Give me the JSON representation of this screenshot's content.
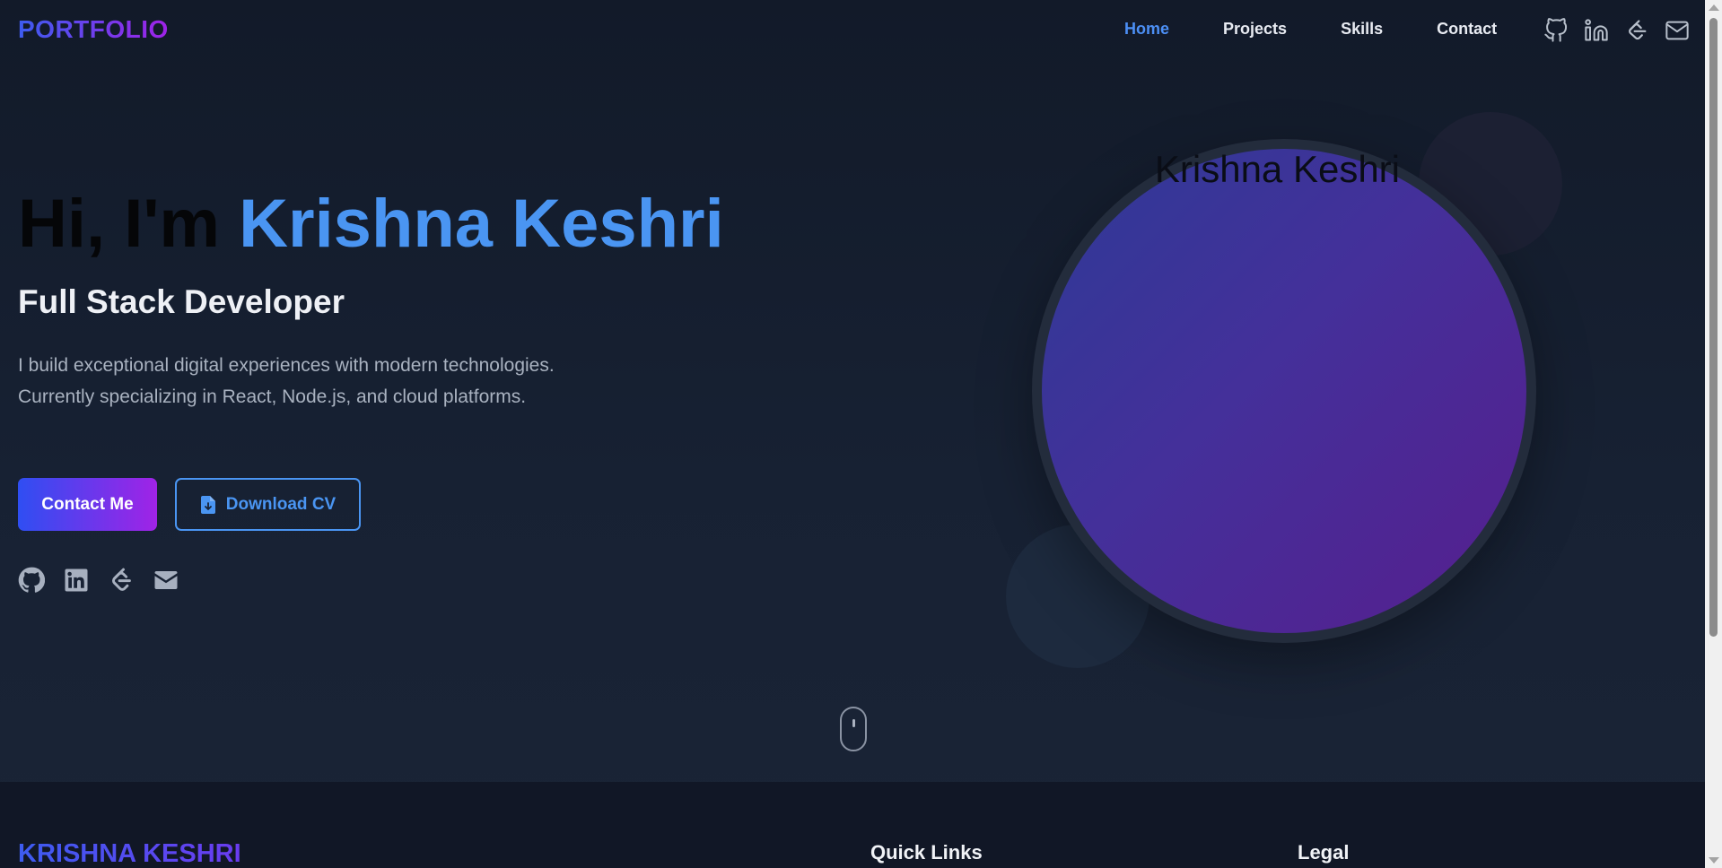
{
  "header": {
    "logo": "PORTFOLIO",
    "nav": [
      {
        "label": "Home",
        "active": true
      },
      {
        "label": "Projects",
        "active": false
      },
      {
        "label": "Skills",
        "active": false
      },
      {
        "label": "Contact",
        "active": false
      }
    ],
    "icons": [
      "github-icon",
      "linkedin-icon",
      "leetcode-icon",
      "mail-icon"
    ]
  },
  "hero": {
    "greeting": "Hi, I'm ",
    "name": "Krishna Keshri",
    "subtitle": "Full Stack Developer",
    "description": "I build exceptional digital experiences with modern technologies. Currently specializing in React, Node.js, and cloud platforms.",
    "contact_button": "Contact Me",
    "download_button": "Download CV",
    "social_icons": [
      "github-icon",
      "linkedin-icon",
      "leetcode-icon",
      "envelope-icon"
    ],
    "image_alt": "Krishna Keshri"
  },
  "footer": {
    "name": "KRISHNA KESHRI",
    "quick_links_heading": "Quick Links",
    "legal_heading": "Legal"
  },
  "colors": {
    "accent_blue": "#4a95f2",
    "gradient_start": "#2f4ef2",
    "gradient_end": "#a023e6",
    "background": "#151c2c"
  }
}
